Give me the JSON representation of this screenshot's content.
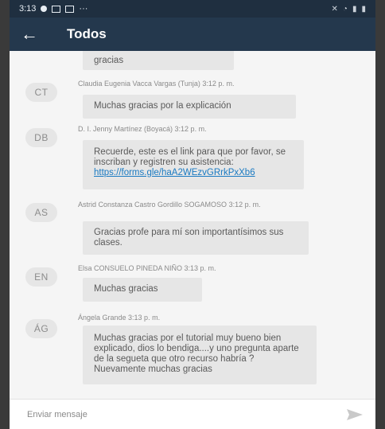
{
  "status_bar": {
    "time": "3:13",
    "more": "···"
  },
  "header": {
    "title": "Todos"
  },
  "messages": [
    {
      "initials": "",
      "sender": "",
      "text": "gracias"
    },
    {
      "initials": "CT",
      "sender": "Claudia Eugenia Vacca Vargas (Tunja) 3:12 p. m.",
      "text": "Muchas gracias por la explicación"
    },
    {
      "initials": "DB",
      "sender": "D. I. Jenny Martínez (Boyacá) 3:12 p. m.",
      "text": "Recuerde, este es el link para que por favor, se inscriban y registren su asistencia: ",
      "link": "https://forms.gle/haA2WEzvGRrkPxXb6"
    },
    {
      "initials": "AS",
      "sender": "Astrid Constanza Castro Gordillo SOGAMOSO 3:12 p. m.",
      "text": "Gracias profe para mí son importantísimos sus clases."
    },
    {
      "initials": "EN",
      "sender": "Elsa CONSUELO PINEDA NIÑO 3:13 p. m.",
      "text": "Muchas gracias"
    },
    {
      "initials": "ÁG",
      "sender": "Ángela Grande 3:13 p. m.",
      "text": "Muchas gracias por el tutorial muy bueno bien explicado, dios lo bendiga....y uno pregunta aparte de la segueta que otro recurso habría ? Nuevamente muchas gracias"
    }
  ],
  "composer": {
    "placeholder": "Enviar mensaje"
  },
  "icons": {
    "back": "arrow-left-icon",
    "send": "send-icon"
  },
  "colors": {
    "status_bar": "#1f2f40",
    "app_bar": "#24384d",
    "bubble": "#e6e6e6",
    "link": "#1a7ac2"
  }
}
